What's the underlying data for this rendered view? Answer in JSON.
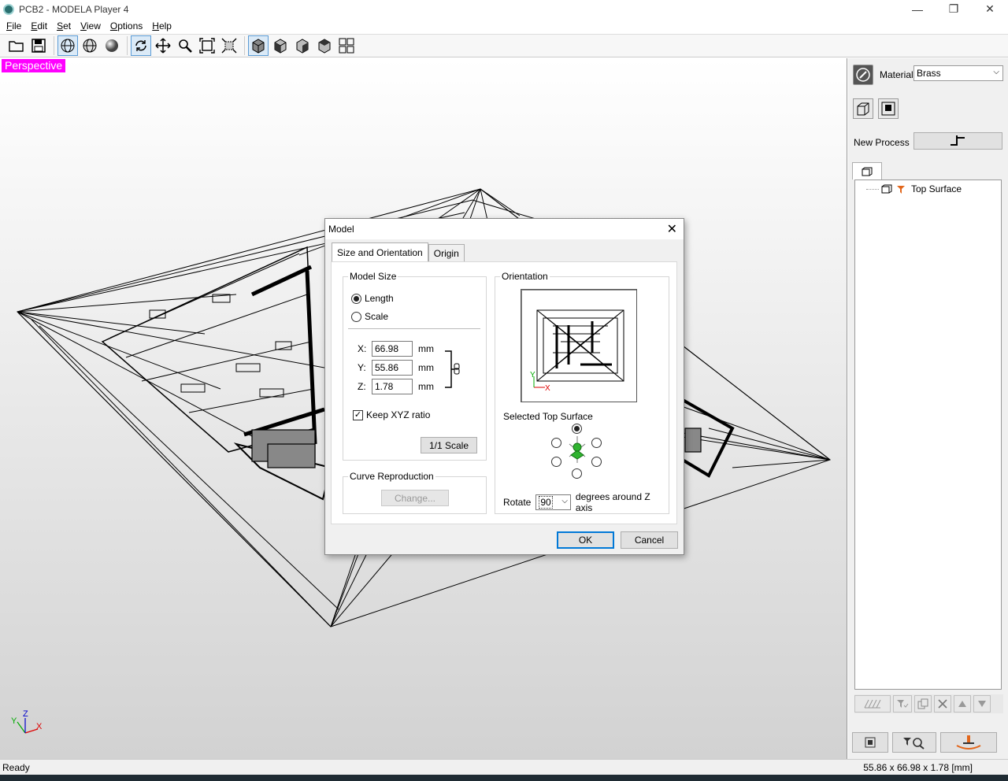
{
  "window": {
    "title": "PCB2 - MODELA Player 4",
    "minimize": "—",
    "maximize": "❐",
    "close": "✕"
  },
  "menu": {
    "file": "File",
    "edit": "Edit",
    "set": "Set",
    "view": "View",
    "options": "Options",
    "help": "Help"
  },
  "viewport": {
    "view_label": "Perspective",
    "axis_x": "X",
    "axis_y": "Y",
    "axis_z": "Z"
  },
  "right_panel": {
    "material_label": "Material",
    "material_value": "Brass",
    "new_process_label": "New Process",
    "tree_items": [
      "Top Surface"
    ]
  },
  "status": {
    "left": "Ready",
    "right": "55.86 x 66.98 x 1.78 [mm]"
  },
  "dialog": {
    "title": "Model",
    "close": "✕",
    "tabs": [
      "Size and Orientation",
      "Origin"
    ],
    "model_size": {
      "title": "Model Size",
      "length": "Length",
      "scale": "Scale",
      "x_label": "X:",
      "y_label": "Y:",
      "z_label": "Z:",
      "x_value": "66.98",
      "y_value": "55.86",
      "z_value": "1.78",
      "unit": "mm",
      "keep_ratio": "Keep XYZ ratio",
      "one_to_one": "1/1 Scale"
    },
    "curve": {
      "title": "Curve Reproduction",
      "change": "Change..."
    },
    "orientation": {
      "title": "Orientation",
      "selected_surface": "Selected Top Surface",
      "rotate_label": "Rotate",
      "rotate_value": "90",
      "rotate_suffix": "degrees around Z axis",
      "axis_x": "X",
      "axis_y": "Y"
    },
    "ok": "OK",
    "cancel": "Cancel"
  }
}
